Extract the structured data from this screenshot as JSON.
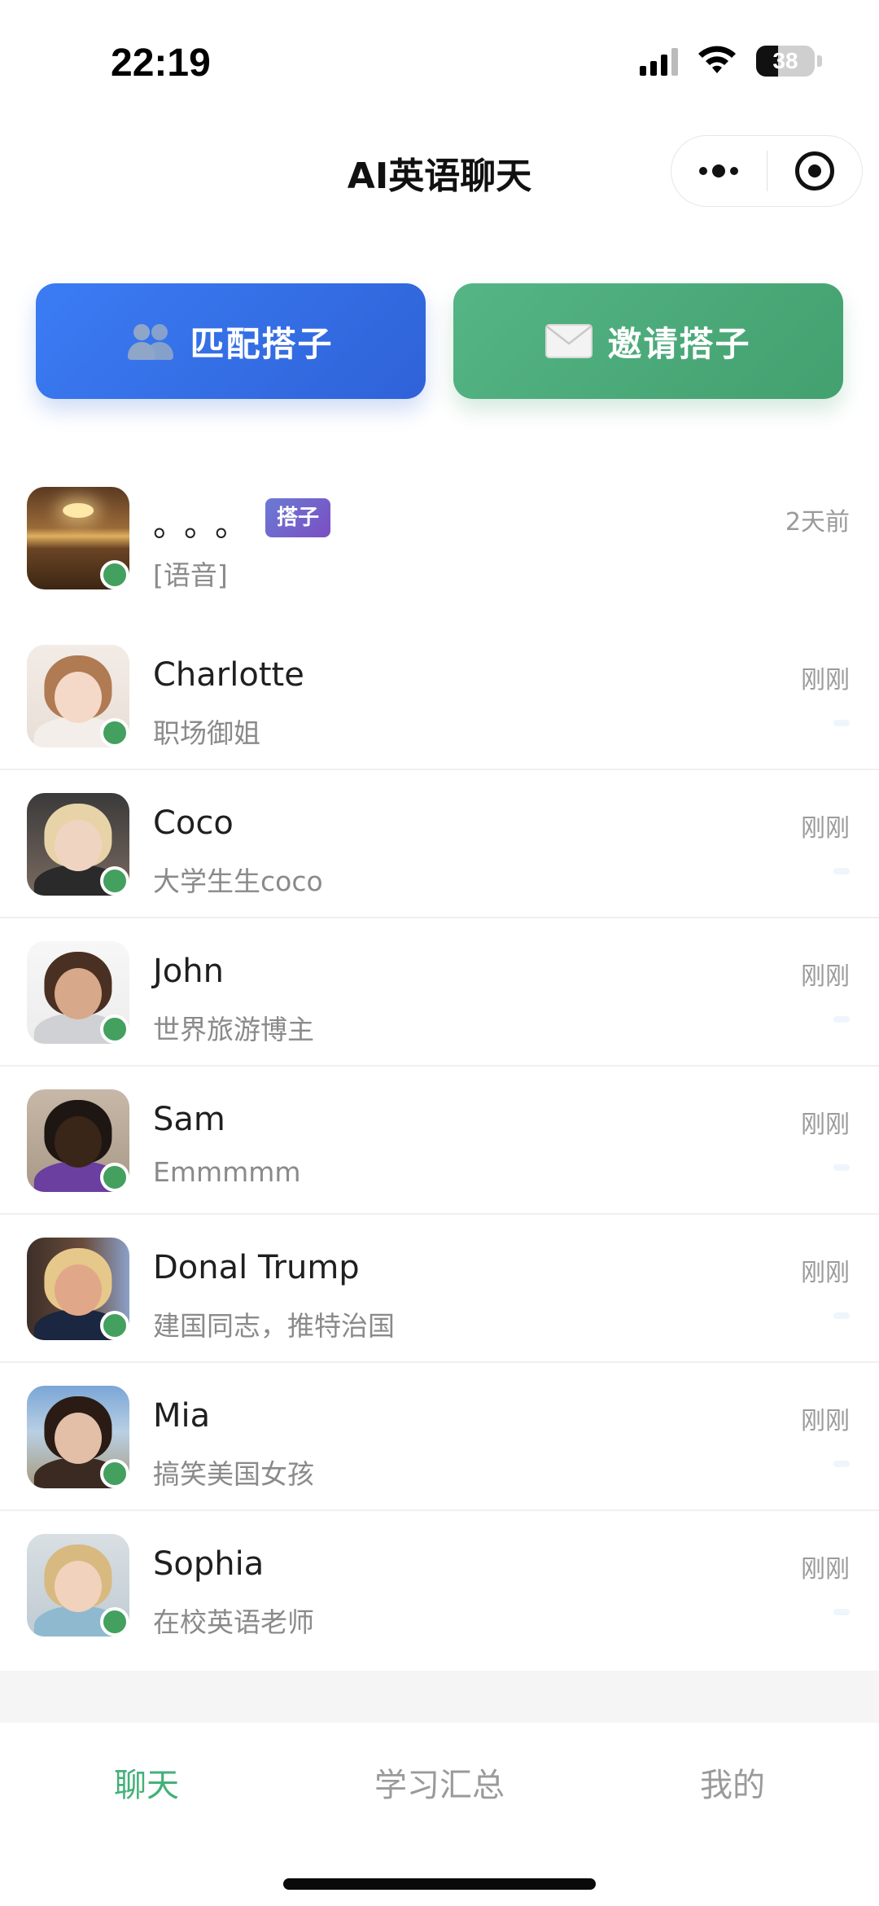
{
  "status_bar": {
    "time": "22:19",
    "battery": "38"
  },
  "nav": {
    "title": "AI英语聊天"
  },
  "actions": {
    "match_label": "匹配搭子",
    "invite_label": "邀请搭子"
  },
  "chats": [
    {
      "name": "。。。",
      "subtitle": "[语音]",
      "time": "2天前",
      "tag": "搭子",
      "avatar": "sunset-avatar"
    },
    {
      "name": "Charlotte",
      "subtitle": "职场御姐",
      "time": "刚刚",
      "avatar": "charlotte-avatar"
    },
    {
      "name": "Coco",
      "subtitle": "大学生生coco",
      "time": "刚刚",
      "avatar": "coco-avatar"
    },
    {
      "name": "John",
      "subtitle": "世界旅游博主",
      "time": "刚刚",
      "avatar": "john-avatar"
    },
    {
      "name": "Sam",
      "subtitle": "Emmmmm",
      "time": "刚刚",
      "avatar": "sam-avatar"
    },
    {
      "name": "Donal Trump",
      "subtitle": "建国同志，推特治国",
      "time": "刚刚",
      "avatar": "trump-avatar"
    },
    {
      "name": "Mia",
      "subtitle": "搞笑美国女孩",
      "time": "刚刚",
      "avatar": "mia-avatar"
    },
    {
      "name": "Sophia",
      "subtitle": "在校英语老师",
      "time": "刚刚",
      "avatar": "sophia-avatar"
    }
  ],
  "tabs": [
    {
      "label": "聊天",
      "active": true
    },
    {
      "label": "学习汇总",
      "active": false
    },
    {
      "label": "我的",
      "active": false
    }
  ],
  "colors": {
    "accent_green": "#43b078",
    "match_blue": "#2f62d8",
    "invite_green": "#43a06f",
    "online_dot": "#43a05f",
    "tag_purple": "#7b4ec2"
  },
  "icons": [
    "signal-icon",
    "wifi-icon",
    "battery-icon",
    "more-icon",
    "target-icon",
    "people-icon",
    "envelope-icon",
    "online-status-icon"
  ]
}
